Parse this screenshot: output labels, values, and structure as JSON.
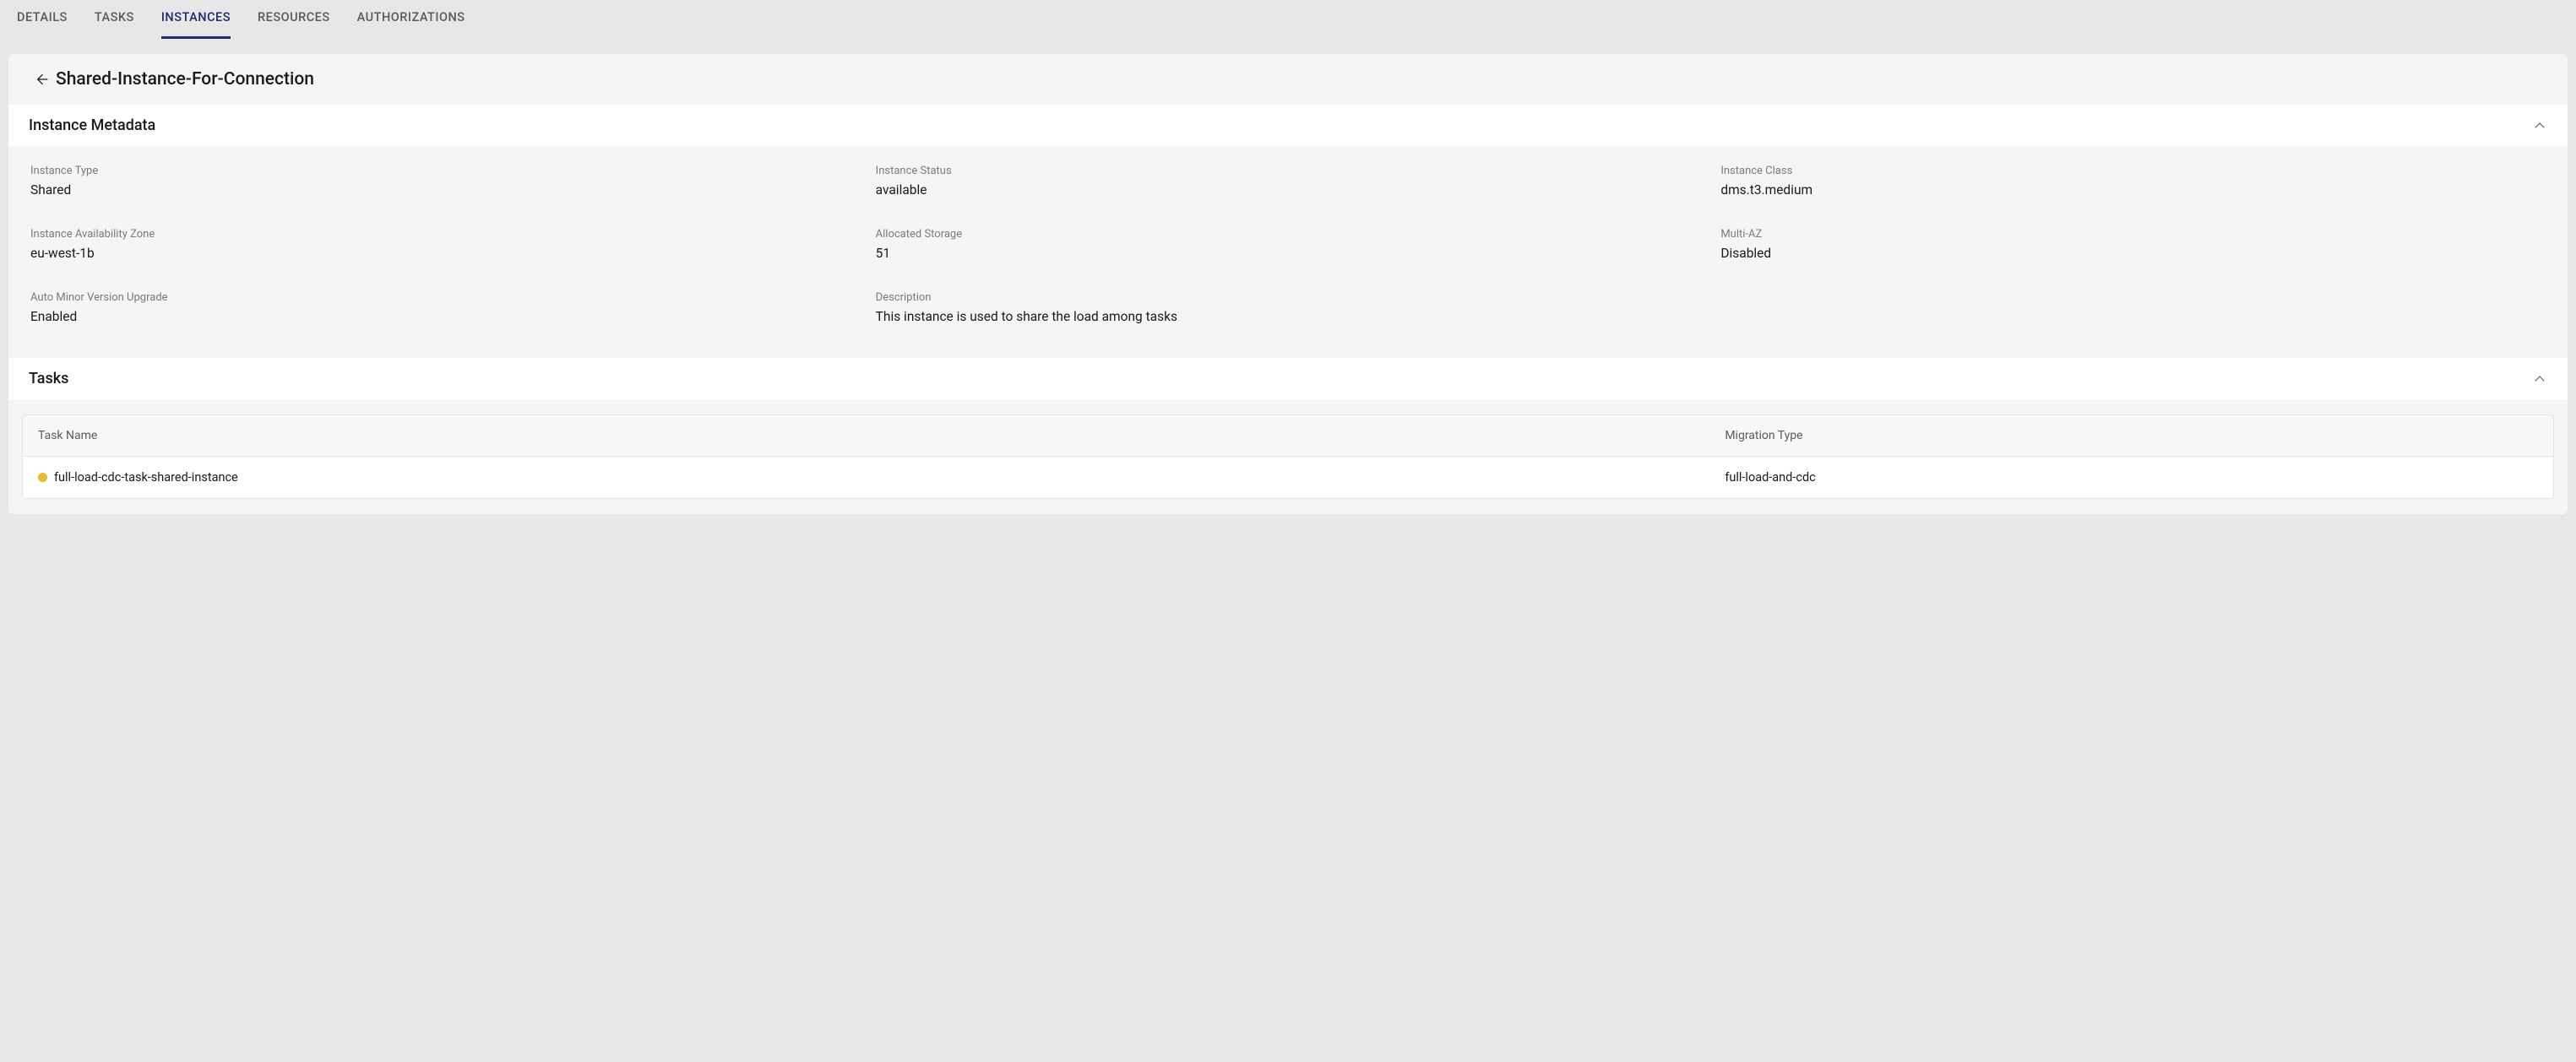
{
  "tabs": [
    {
      "label": "DETAILS",
      "active": false
    },
    {
      "label": "TASKS",
      "active": false
    },
    {
      "label": "INSTANCES",
      "active": true
    },
    {
      "label": "RESOURCES",
      "active": false
    },
    {
      "label": "AUTHORIZATIONS",
      "active": false
    }
  ],
  "header": {
    "title": "Shared-Instance-For-Connection"
  },
  "metadataSection": {
    "title": "Instance Metadata",
    "fields": {
      "instanceType": {
        "label": "Instance Type",
        "value": "Shared"
      },
      "instanceStatus": {
        "label": "Instance Status",
        "value": "available"
      },
      "instanceClass": {
        "label": "Instance Class",
        "value": "dms.t3.medium"
      },
      "availabilityZone": {
        "label": "Instance Availability Zone",
        "value": "eu-west-1b"
      },
      "allocatedStorage": {
        "label": "Allocated Storage",
        "value": "51"
      },
      "multiAz": {
        "label": "Multi-AZ",
        "value": "Disabled"
      },
      "autoMinorUpgrade": {
        "label": "Auto Minor Version Upgrade",
        "value": "Enabled"
      },
      "description": {
        "label": "Description",
        "value": "This instance is used to share the load among tasks"
      }
    }
  },
  "tasksSection": {
    "title": "Tasks",
    "columns": {
      "taskName": "Task Name",
      "migrationType": "Migration Type"
    },
    "rows": [
      {
        "statusColor": "#e8b931",
        "taskName": "full-load-cdc-task-shared-instance",
        "migrationType": "full-load-and-cdc"
      }
    ]
  }
}
